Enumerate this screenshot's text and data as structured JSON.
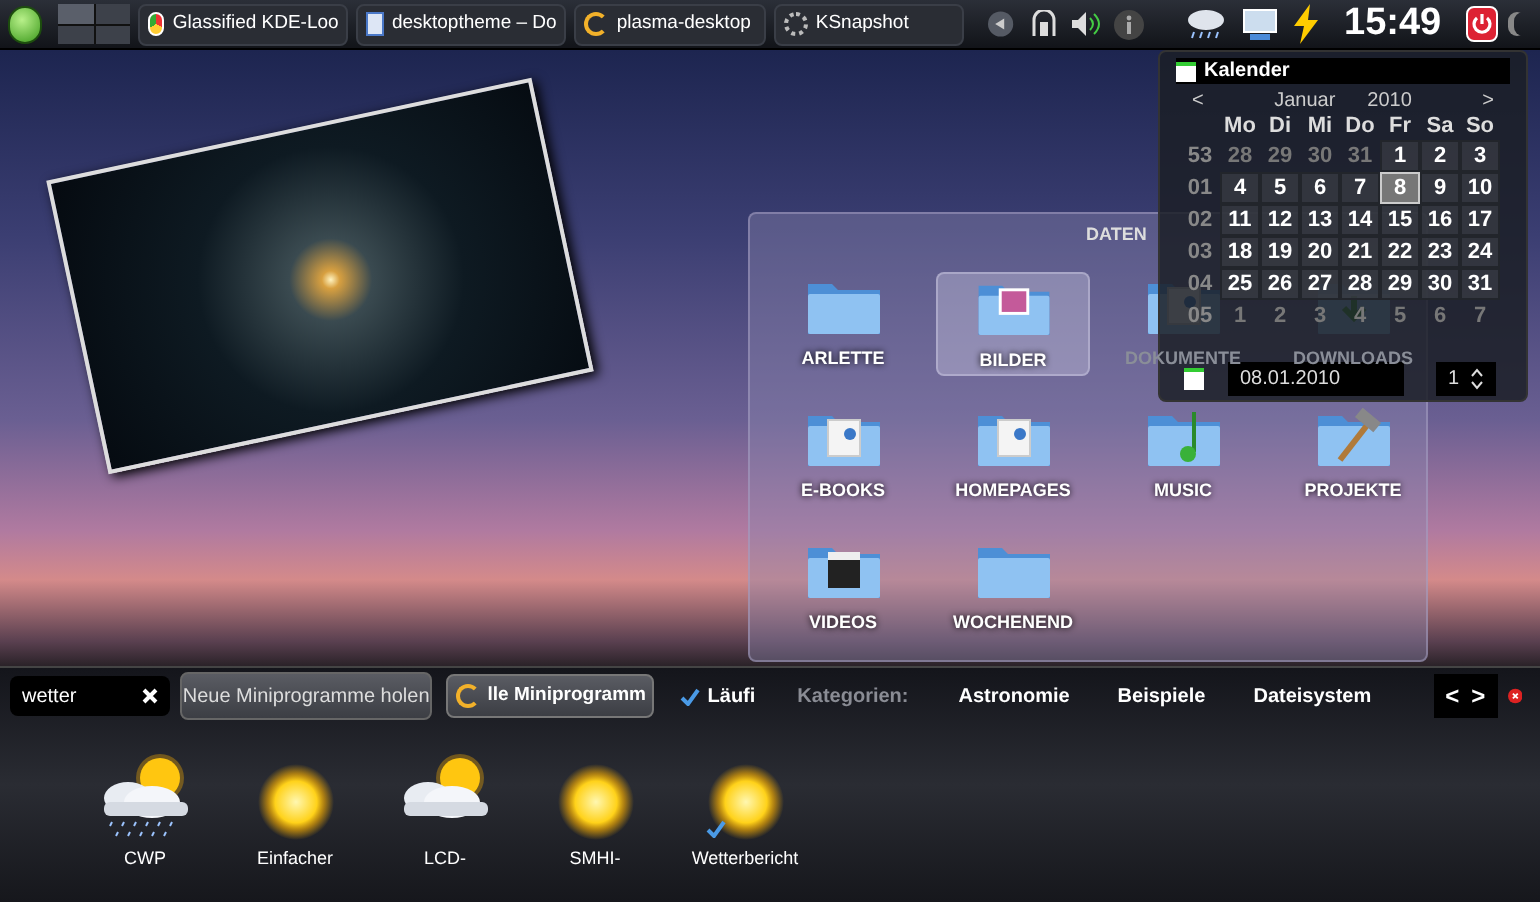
{
  "panel": {
    "tasks": [
      {
        "label": "Glassified KDE-Loo",
        "kind": "browser"
      },
      {
        "label": "desktoptheme – Do",
        "kind": "document"
      },
      {
        "label": "plasma-desktop",
        "kind": "plasma"
      },
      {
        "label": "KSnapshot",
        "kind": "loading"
      }
    ],
    "clock": "15:49"
  },
  "folder_view": {
    "title": "DATEN",
    "items": [
      {
        "label": "ARLETTE",
        "kind": "plain",
        "selected": false
      },
      {
        "label": "BILDER",
        "kind": "pictures",
        "selected": true
      },
      {
        "label": "DOKUMENTE",
        "kind": "documents",
        "selected": false
      },
      {
        "label": "DOWNLOADS",
        "kind": "downloads",
        "selected": false
      },
      {
        "label": "E-BOOKS",
        "kind": "documents",
        "selected": false
      },
      {
        "label": "HOMEPAGES",
        "kind": "documents",
        "selected": false
      },
      {
        "label": "MUSIC",
        "kind": "music",
        "selected": false
      },
      {
        "label": "PROJEKTE",
        "kind": "tools",
        "selected": false
      },
      {
        "label": "VIDEOS",
        "kind": "video",
        "selected": false
      },
      {
        "label": "WOCHENEND",
        "kind": "plain",
        "selected": false
      }
    ]
  },
  "calendar": {
    "title": "Kalender",
    "prev": "<",
    "next": ">",
    "month": "Januar",
    "year": "2010",
    "weekdays": [
      "Mo",
      "Di",
      "Mi",
      "Do",
      "Fr",
      "Sa",
      "So"
    ],
    "weeks": [
      {
        "number": "53",
        "days": [
          {
            "label": "28",
            "current": false,
            "selected": false
          },
          {
            "label": "29",
            "current": false,
            "selected": false
          },
          {
            "label": "30",
            "current": false,
            "selected": false
          },
          {
            "label": "31",
            "current": false,
            "selected": false
          },
          {
            "label": "1",
            "current": true,
            "selected": false
          },
          {
            "label": "2",
            "current": true,
            "selected": false
          },
          {
            "label": "3",
            "current": true,
            "selected": false
          }
        ]
      },
      {
        "number": "01",
        "days": [
          {
            "label": "4",
            "current": true,
            "selected": false
          },
          {
            "label": "5",
            "current": true,
            "selected": false
          },
          {
            "label": "6",
            "current": true,
            "selected": false
          },
          {
            "label": "7",
            "current": true,
            "selected": false
          },
          {
            "label": "8",
            "current": true,
            "selected": true
          },
          {
            "label": "9",
            "current": true,
            "selected": false
          },
          {
            "label": "10",
            "current": true,
            "selected": false
          }
        ]
      },
      {
        "number": "02",
        "days": [
          {
            "label": "11",
            "current": true,
            "selected": false
          },
          {
            "label": "12",
            "current": true,
            "selected": false
          },
          {
            "label": "13",
            "current": true,
            "selected": false
          },
          {
            "label": "14",
            "current": true,
            "selected": false
          },
          {
            "label": "15",
            "current": true,
            "selected": false
          },
          {
            "label": "16",
            "current": true,
            "selected": false
          },
          {
            "label": "17",
            "current": true,
            "selected": false
          }
        ]
      },
      {
        "number": "03",
        "days": [
          {
            "label": "18",
            "current": true,
            "selected": false
          },
          {
            "label": "19",
            "current": true,
            "selected": false
          },
          {
            "label": "20",
            "current": true,
            "selected": false
          },
          {
            "label": "21",
            "current": true,
            "selected": false
          },
          {
            "label": "22",
            "current": true,
            "selected": false
          },
          {
            "label": "23",
            "current": true,
            "selected": false
          },
          {
            "label": "24",
            "current": true,
            "selected": false
          }
        ]
      },
      {
        "number": "04",
        "days": [
          {
            "label": "25",
            "current": true,
            "selected": false
          },
          {
            "label": "26",
            "current": true,
            "selected": false
          },
          {
            "label": "27",
            "current": true,
            "selected": false
          },
          {
            "label": "28",
            "current": true,
            "selected": false
          },
          {
            "label": "29",
            "current": true,
            "selected": false
          },
          {
            "label": "30",
            "current": true,
            "selected": false
          },
          {
            "label": "31",
            "current": true,
            "selected": false
          }
        ]
      },
      {
        "number": "05",
        "days": [
          {
            "label": "1",
            "current": false,
            "selected": false
          },
          {
            "label": "2",
            "current": false,
            "selected": false
          },
          {
            "label": "3",
            "current": false,
            "selected": false
          },
          {
            "label": "4",
            "current": false,
            "selected": false
          },
          {
            "label": "5",
            "current": false,
            "selected": false
          },
          {
            "label": "6",
            "current": false,
            "selected": false
          },
          {
            "label": "7",
            "current": false,
            "selected": false
          }
        ]
      }
    ],
    "date_field": "08.01.2010",
    "week_field": "1"
  },
  "widget_explorer": {
    "search": "wetter",
    "get_new_button": "Neue Miniprogramme holen",
    "filter_button": "lle Miniprogramm",
    "running_filter": {
      "label": "Läufi",
      "checked": true
    },
    "categories_label": "Kategorien:",
    "categories": [
      "Astronomie",
      "Beispiele",
      "Dateisystem"
    ],
    "prev": "<",
    "next": ">",
    "widgets": [
      {
        "label": "CWP",
        "kind": "rain",
        "running": false
      },
      {
        "label": "Einfacher",
        "kind": "sun",
        "running": false
      },
      {
        "label": "LCD-",
        "kind": "cloud",
        "running": false
      },
      {
        "label": "SMHI-",
        "kind": "sun",
        "running": false
      },
      {
        "label": "Wetterbericht",
        "kind": "sun",
        "running": true
      }
    ]
  }
}
